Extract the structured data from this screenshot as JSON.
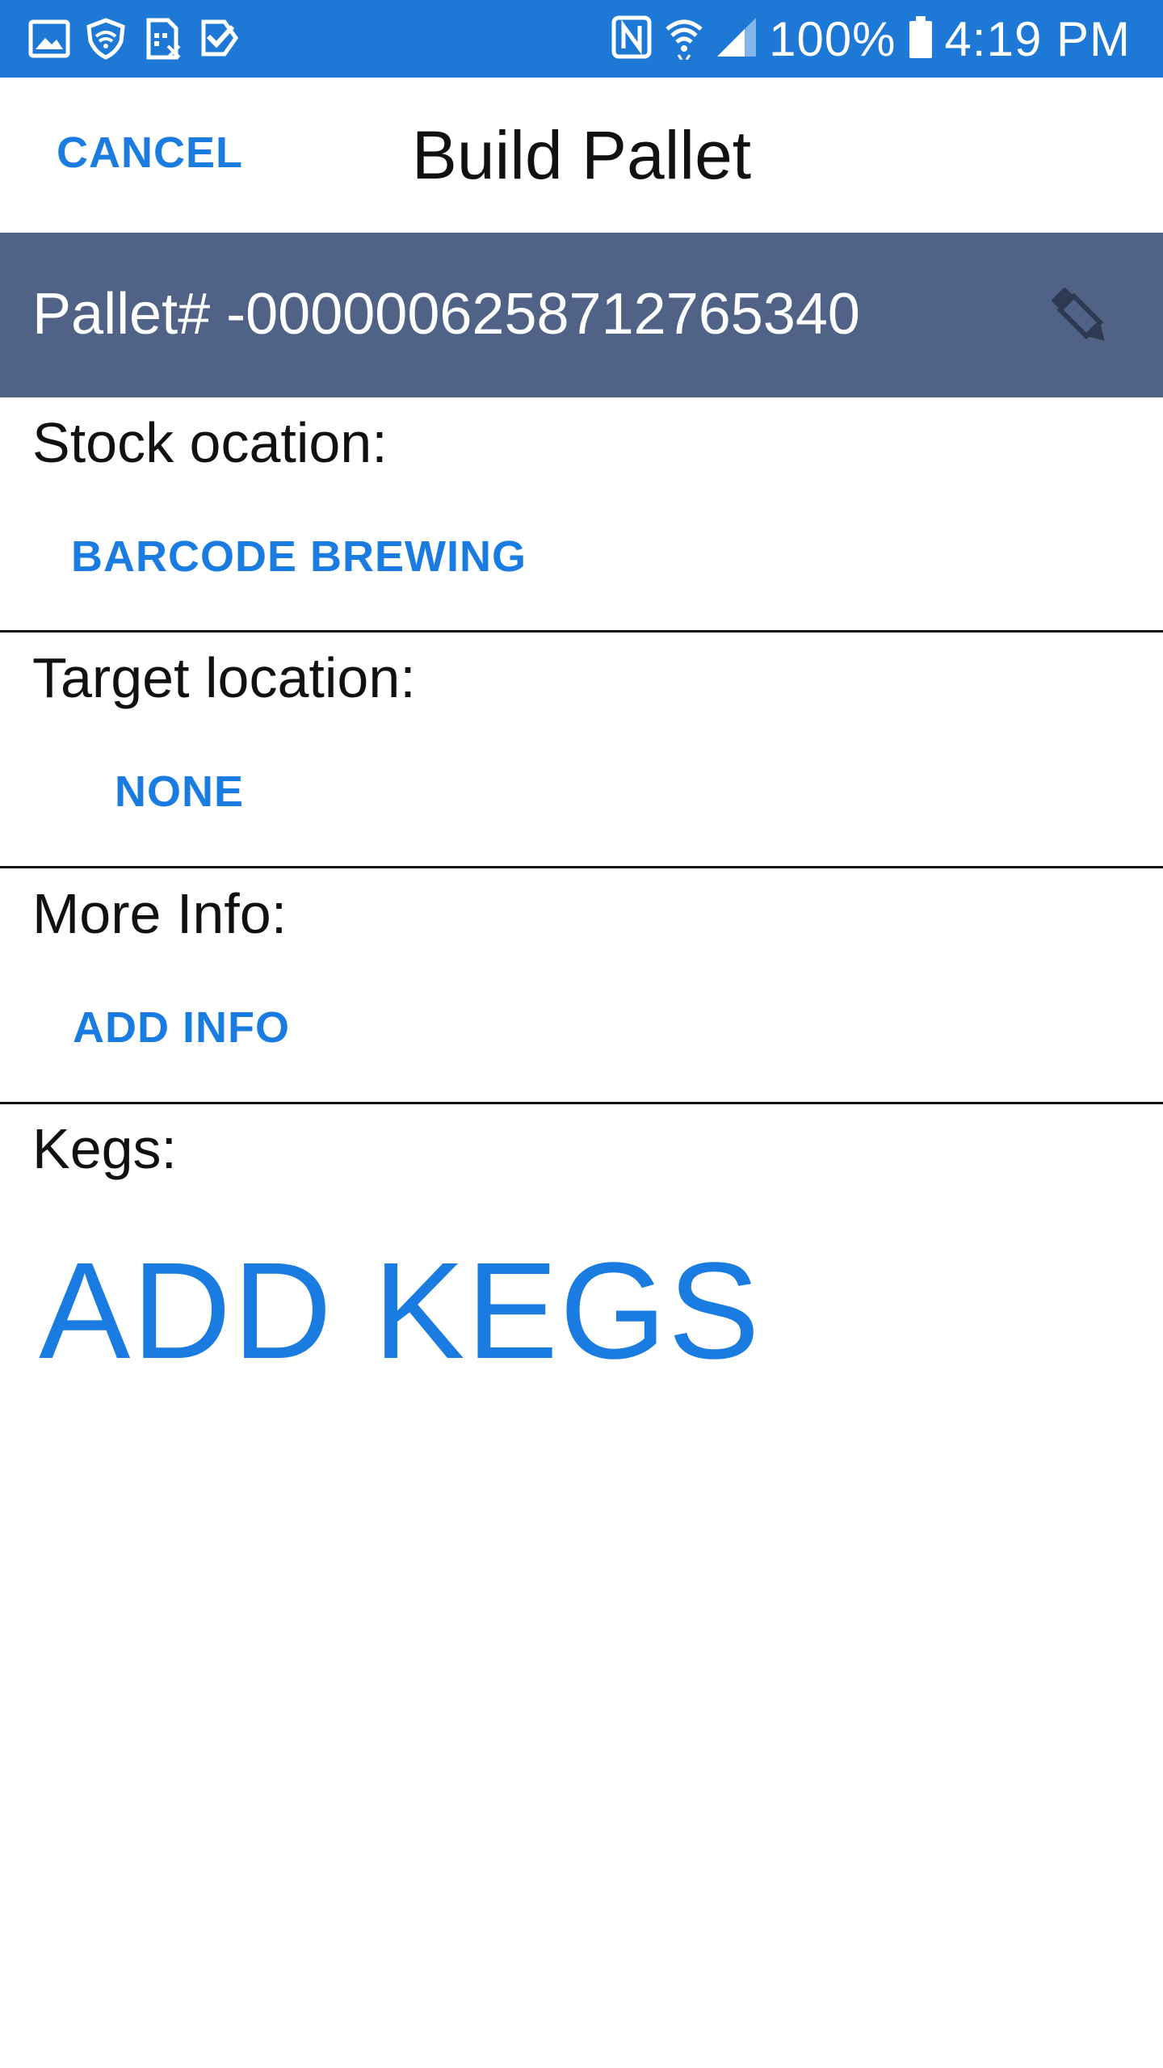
{
  "status_bar": {
    "battery": "100%",
    "time": "4:19 PM",
    "left_icons": [
      "gallery-icon",
      "vpn-shield-icon",
      "sim-icon",
      "check-icon"
    ],
    "right_icons": [
      "nfc-icon",
      "wifi-icon",
      "signal-icon",
      "battery-icon"
    ]
  },
  "toolbar": {
    "cancel_label": "CANCEL",
    "title": "Build Pallet"
  },
  "pallet": {
    "label": "Pallet# -0000006258712765340",
    "edit_icon": "pencil-icon"
  },
  "stock_location": {
    "label": "Stock ocation:",
    "value": "BARCODE BREWING"
  },
  "target_location": {
    "label": "Target location:",
    "value": "NONE"
  },
  "more_info": {
    "label": "More Info:",
    "value": "ADD INFO"
  },
  "kegs": {
    "label": "Kegs:",
    "action": "ADD KEGS"
  },
  "colors": {
    "status_bar": "#1e78d6",
    "pallet_bar": "#506285",
    "accent": "#1a7ce0"
  }
}
